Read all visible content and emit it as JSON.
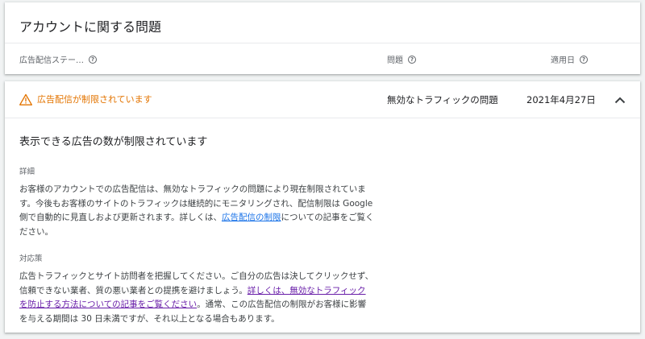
{
  "section": {
    "title": "アカウントに関する問題",
    "columns": {
      "status": "広告配信ステー…",
      "issue": "問題",
      "date": "適用日"
    }
  },
  "issue_row": {
    "status_label": "広告配信が制限されています",
    "issue": "無効なトラフィックの問題",
    "date": "2021年4月27日",
    "status_color": "#e37400"
  },
  "details": {
    "heading": "表示できる広告の数が制限されています",
    "detail_label": "詳細",
    "detail_text_before": "お客様のアカウントでの広告配信は、無効なトラフィックの問題により現在制限されています。今後もお客様のサイトのトラフィックは継続的にモニタリングされ、配信制限は Google 側で自動的に見直しおよび更新されます。詳しくは、",
    "detail_link": "広告配信の制限",
    "detail_text_after": "についての記事をご覧ください。",
    "action_label": "対応策",
    "action_text_before": "広告トラフィックとサイト訪問者を把握してください。ご自分の広告は決してクリックせず、信頼できない業者、質の悪い業者との提携を避けましょう。",
    "action_link": "詳しくは、無効なトラフィックを防止する方法についての記事をご覧ください",
    "action_text_after": "。通常、この広告配信の制限がお客様に影響を与える期間は 30 日未満ですが、それ以上となる場合もあります。"
  },
  "colors": {
    "warning": "#e37400",
    "link": "#1a73e8",
    "visited_link": "#681da8"
  }
}
